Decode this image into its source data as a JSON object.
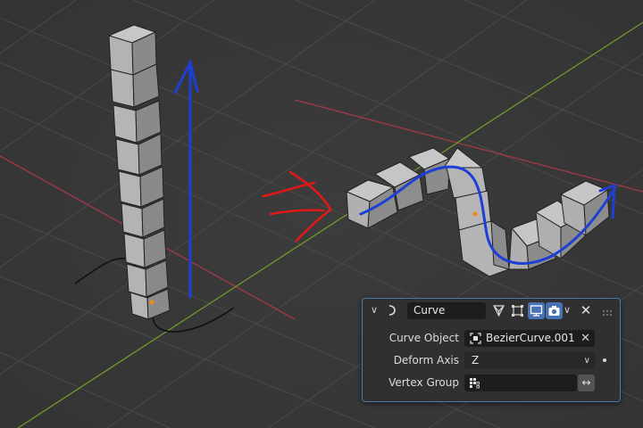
{
  "modifier": {
    "name": "Curve",
    "header_icons": [
      "curve-modifier-icon",
      "edit-mode-icon",
      "cage-icon",
      "realtime-icon",
      "render-icon",
      "dropdown-chevron-icon",
      "close-icon",
      "drag-handle-icon"
    ],
    "curve_object_label": "Curve Object",
    "curve_object_value": "BezierCurve.001",
    "deform_axis_label": "Deform Axis",
    "deform_axis_value": "Z",
    "vertex_group_label": "Vertex Group",
    "vertex_group_value": ""
  },
  "colors": {
    "viewport_bg": "#393939",
    "x_axis": "#a23a46",
    "y_axis": "#6c9a2c",
    "annotation_blue": "#1e3fd6",
    "annotation_red": "#e01818",
    "panel_border": "#4d79a8",
    "toggle_active": "#4772b3"
  }
}
